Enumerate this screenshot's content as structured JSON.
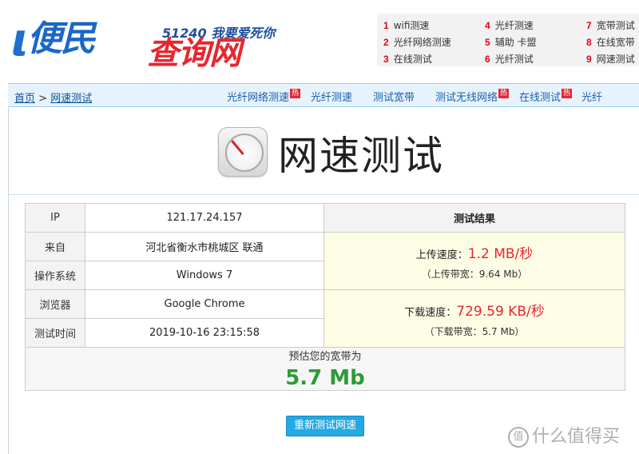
{
  "header": {
    "slogan": "51240 我要爱死你",
    "brand_left": "便民",
    "brand_right": "查询网",
    "top_links": [
      {
        "num": "1",
        "label": "wifi测速"
      },
      {
        "num": "2",
        "label": "光纤网络测速"
      },
      {
        "num": "3",
        "label": "在线测试"
      },
      {
        "num": "4",
        "label": "光纤测速"
      },
      {
        "num": "5",
        "label": "辅助 卡盟"
      },
      {
        "num": "6",
        "label": "光纤测试"
      },
      {
        "num": "7",
        "label": "宽带测试"
      },
      {
        "num": "8",
        "label": "在线宽带"
      },
      {
        "num": "9",
        "label": "网速测试"
      }
    ]
  },
  "nav": {
    "home": "首页",
    "separator": ">",
    "current": "网速测试",
    "hot_badge": "热",
    "links": [
      "光纤网络测速",
      "光纤测速",
      "测试宽带",
      "测试无线网络",
      "在线测试",
      "光纤"
    ]
  },
  "main": {
    "title": "网速测试",
    "rows": [
      {
        "label": "IP",
        "value": "121.17.24.157"
      },
      {
        "label": "来自",
        "value": "河北省衡水市桃城区 联通"
      },
      {
        "label": "操作系统",
        "value": "Windows 7"
      },
      {
        "label": "浏览器",
        "value": "Google Chrome"
      },
      {
        "label": "测试时间",
        "value": "2019-10-16 23:15:58"
      }
    ],
    "result_header": "测试结果",
    "upload_label": "上传速度：",
    "upload_value": "1.2 MB/秒",
    "upload_bw": "（上传带宽：9.64 Mb）",
    "download_label": "下载速度：",
    "download_value": "729.59 KB/秒",
    "download_bw": "（下载带宽：5.7 Mb）",
    "estimate_label": "预估您的宽带为",
    "estimate_value": "5.7 Mb",
    "retest_button": "重新测试网速"
  },
  "watermark": {
    "icon_text": "值",
    "text": "什么值得买"
  }
}
